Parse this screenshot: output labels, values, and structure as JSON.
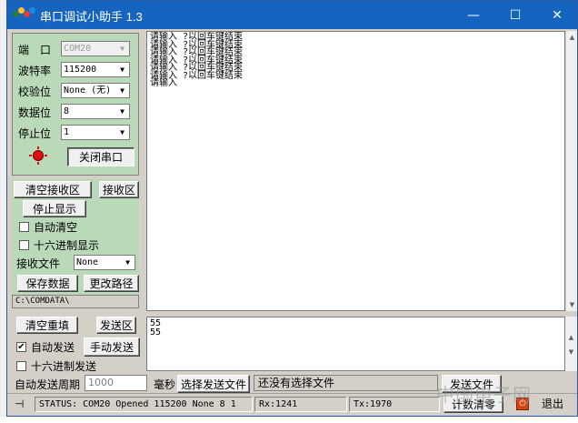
{
  "window": {
    "title": "串口调试小助手 1.3",
    "icon_name": "serial-port-app-icon",
    "controls": {
      "minimize": "—",
      "maximize": "☐",
      "close": "✕"
    },
    "title_color": "#1565c0"
  },
  "config": {
    "port_label": "端　口",
    "port_value": "COM20",
    "baud_label": "波特率",
    "baud_value": "115200",
    "parity_label": "校验位",
    "parity_value": "None (无)",
    "databits_label": "数据位",
    "databits_value": "8",
    "stopbits_label": "停止位",
    "stopbits_value": "1",
    "indicator_color": "#e01010",
    "close_port_button": "关闭串口"
  },
  "receive": {
    "clear_button": "清空接收区",
    "area_button": "接收区",
    "stop_display_button": "停止显示",
    "auto_clear_label": "自动清空",
    "auto_clear_checked": false,
    "hex_display_label": "十六进制显示",
    "hex_display_checked": false,
    "file_label": "接收文件",
    "file_value": "None",
    "save_button": "保存数据",
    "change_path_button": "更改路径",
    "path": "C:\\COMDATA\\",
    "lines": [
      "请输入  ?以回车键结束",
      "请输入  ?以回车键结束",
      "请输入  ?以回车键结束",
      "请输入  ?以回车键结束",
      "请输入  ?以回车键结束",
      "请输入  ?以回车键结束",
      "请输入"
    ]
  },
  "send": {
    "clear_button": "清空重填",
    "area_button": "发送区",
    "auto_send_label": "自动发送",
    "auto_send_checked": true,
    "manual_send_button": "手动发送",
    "hex_send_label": "十六进制发送",
    "hex_send_checked": false,
    "lines": [
      "55",
      "55"
    ],
    "period_label": "自动发送周期",
    "period_value": "1000",
    "ms_label": "毫秒",
    "choose_file_button": "选择发送文件",
    "file_status": "还没有选择文件",
    "send_file_button": "发送文件"
  },
  "statusbar": {
    "status": "STATUS: COM20 Opened 115200 None  8 1",
    "rx": "Rx:1241",
    "tx": "Tx:1970",
    "count_clear_button": "计数清零",
    "exit_button": "退出"
  },
  "watermark": "中国电子网"
}
